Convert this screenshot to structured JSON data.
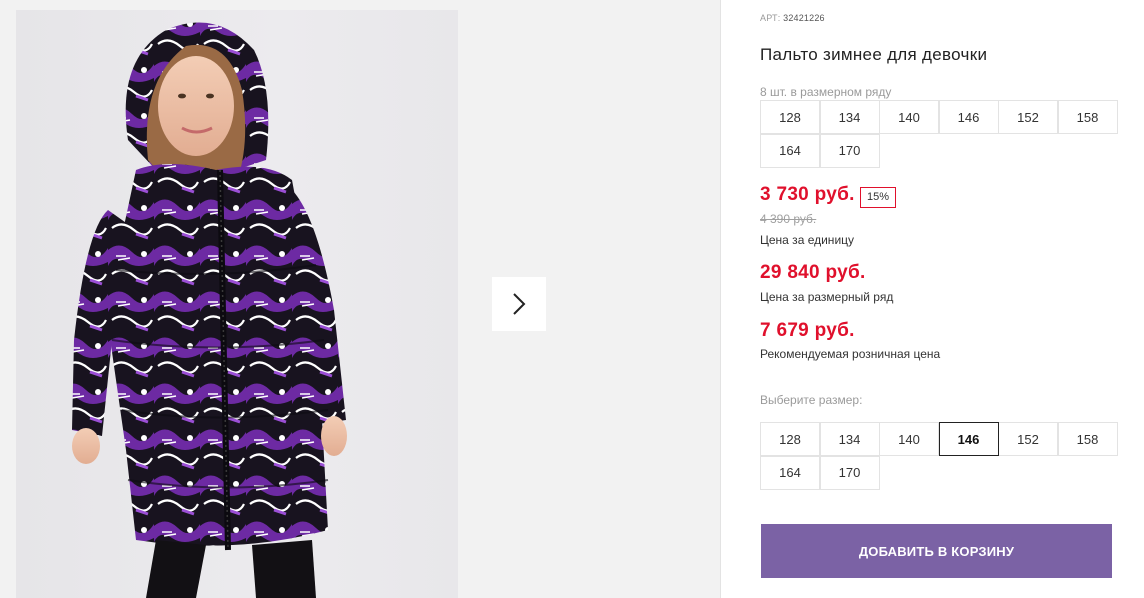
{
  "product": {
    "art_label": "АРТ:",
    "art_number": "32421226",
    "title": "Пальто зимнее для девочки"
  },
  "gallery": {
    "image_alt": "Девочка в зимнем пальто с фиолетово-черным граффити-принтом",
    "next_icon": "chevron-right-icon"
  },
  "size_range": {
    "caption": "8 шт. в размерном ряду",
    "sizes": [
      "128",
      "134",
      "140",
      "146",
      "152",
      "158",
      "164",
      "170"
    ]
  },
  "prices": {
    "unit_price": "3 730 руб.",
    "discount": "15%",
    "old_price": "4 390 руб.",
    "unit_label": "Цена за единицу",
    "range_price": "29 840 руб.",
    "range_label": "Цена за размерный ряд",
    "retail_price": "7 679 руб.",
    "retail_label": "Рекомендуемая розничная цена"
  },
  "size_select": {
    "caption": "Выберите размер:",
    "sizes": [
      "128",
      "134",
      "140",
      "146",
      "152",
      "158",
      "164",
      "170"
    ],
    "selected": "146"
  },
  "cart": {
    "add_label": "ДОБАВИТЬ В КОРЗИНУ"
  },
  "colors": {
    "accent_price": "#e0102c",
    "button": "#7b62a5",
    "coat_purple": "#6b2aa0",
    "coat_black": "#16121c"
  }
}
